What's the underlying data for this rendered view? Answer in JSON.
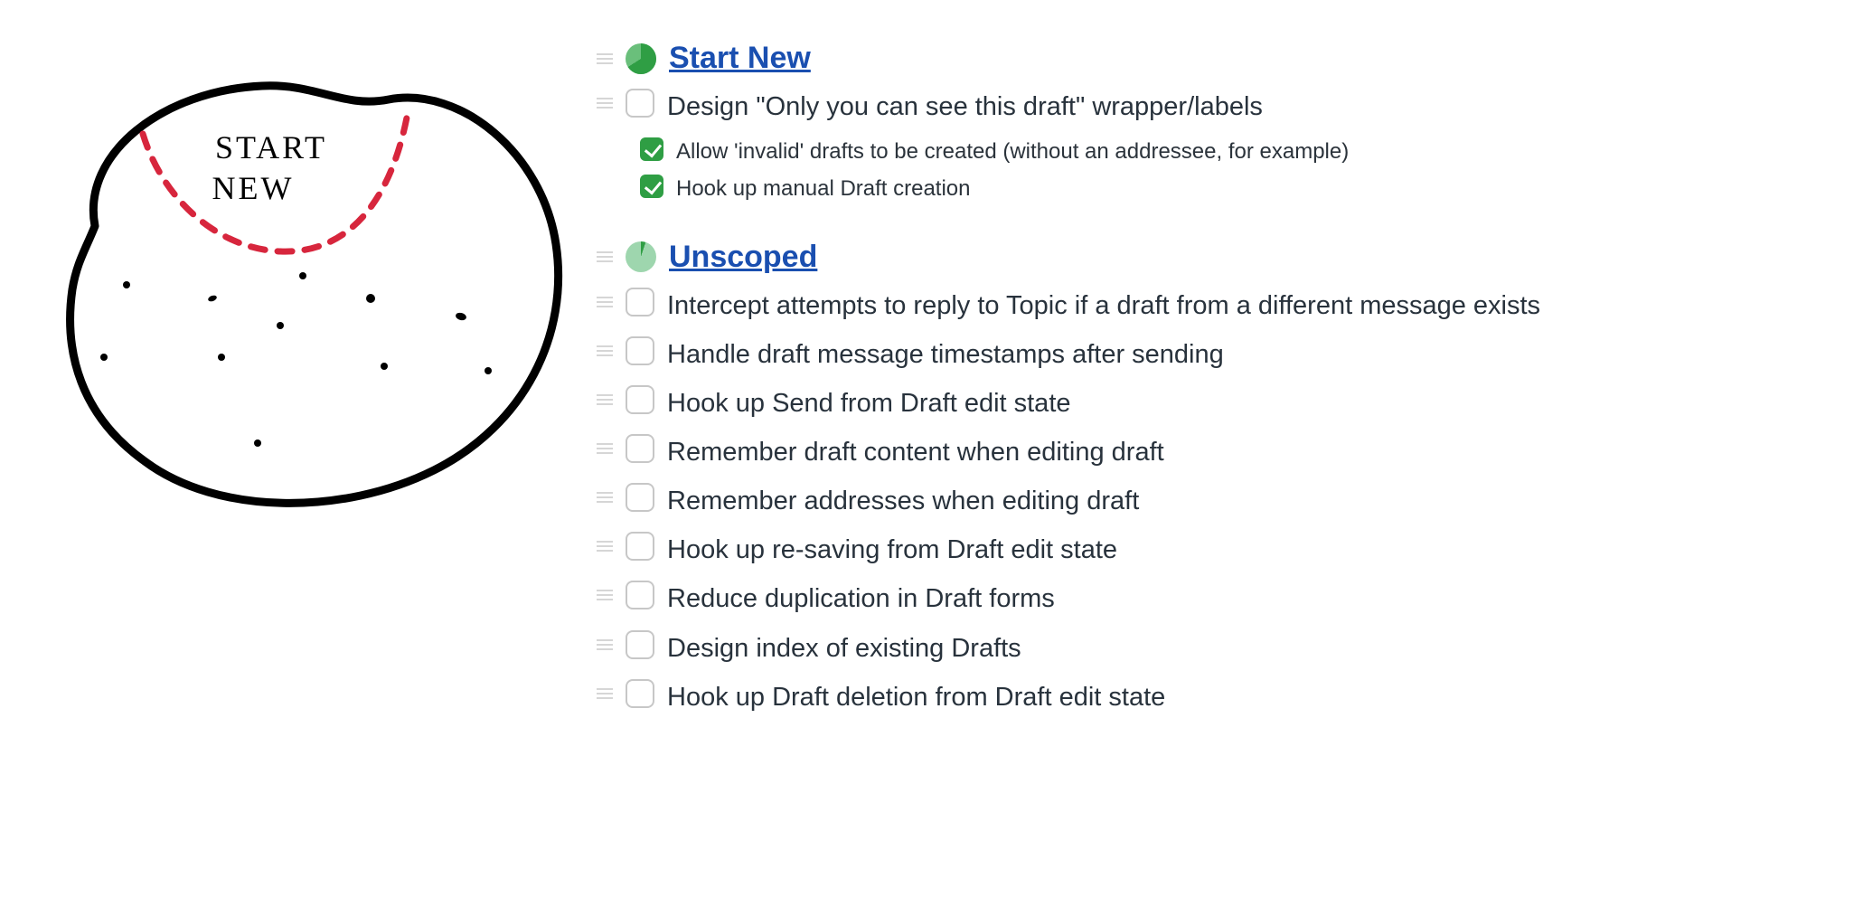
{
  "sketch": {
    "label_line1": "START",
    "label_line2": "NEW"
  },
  "sections": [
    {
      "id": "start-new",
      "title": "Start New",
      "pie_complete_pct": 66,
      "pie_dark": "#2f9e44",
      "pie_light": "#6abf7b",
      "tasks": [
        {
          "id": "design-wrapper",
          "checked": false,
          "text": "Design \"Only you can see this draft\" wrapper/labels"
        }
      ],
      "subtasks": [
        {
          "id": "allow-invalid",
          "checked": true,
          "text": "Allow 'invalid' drafts to be created (without an addressee, for example)"
        },
        {
          "id": "hook-manual",
          "checked": true,
          "text": "Hook up manual Draft creation"
        }
      ]
    },
    {
      "id": "unscoped",
      "title": "Unscoped",
      "pie_complete_pct": 5,
      "pie_dark": "#2f9e44",
      "pie_light": "#9ed6ae",
      "tasks": [
        {
          "id": "intercept-reply",
          "checked": false,
          "text": "Intercept attempts to reply to Topic if a draft from a different message exists"
        },
        {
          "id": "handle-timestamps",
          "checked": false,
          "text": "Handle draft message timestamps after sending"
        },
        {
          "id": "hook-send",
          "checked": false,
          "text": "Hook up Send from Draft edit state"
        },
        {
          "id": "remember-content",
          "checked": false,
          "text": "Remember draft content when editing draft"
        },
        {
          "id": "remember-addresses",
          "checked": false,
          "text": "Remember addresses when editing draft"
        },
        {
          "id": "hook-resave",
          "checked": false,
          "text": "Hook up re-saving from Draft edit state"
        },
        {
          "id": "reduce-dup",
          "checked": false,
          "text": "Reduce duplication in Draft forms"
        },
        {
          "id": "design-index",
          "checked": false,
          "text": "Design index of existing Drafts"
        },
        {
          "id": "hook-deletion",
          "checked": false,
          "text": "Hook up Draft deletion from Draft edit state"
        }
      ],
      "subtasks": []
    }
  ]
}
